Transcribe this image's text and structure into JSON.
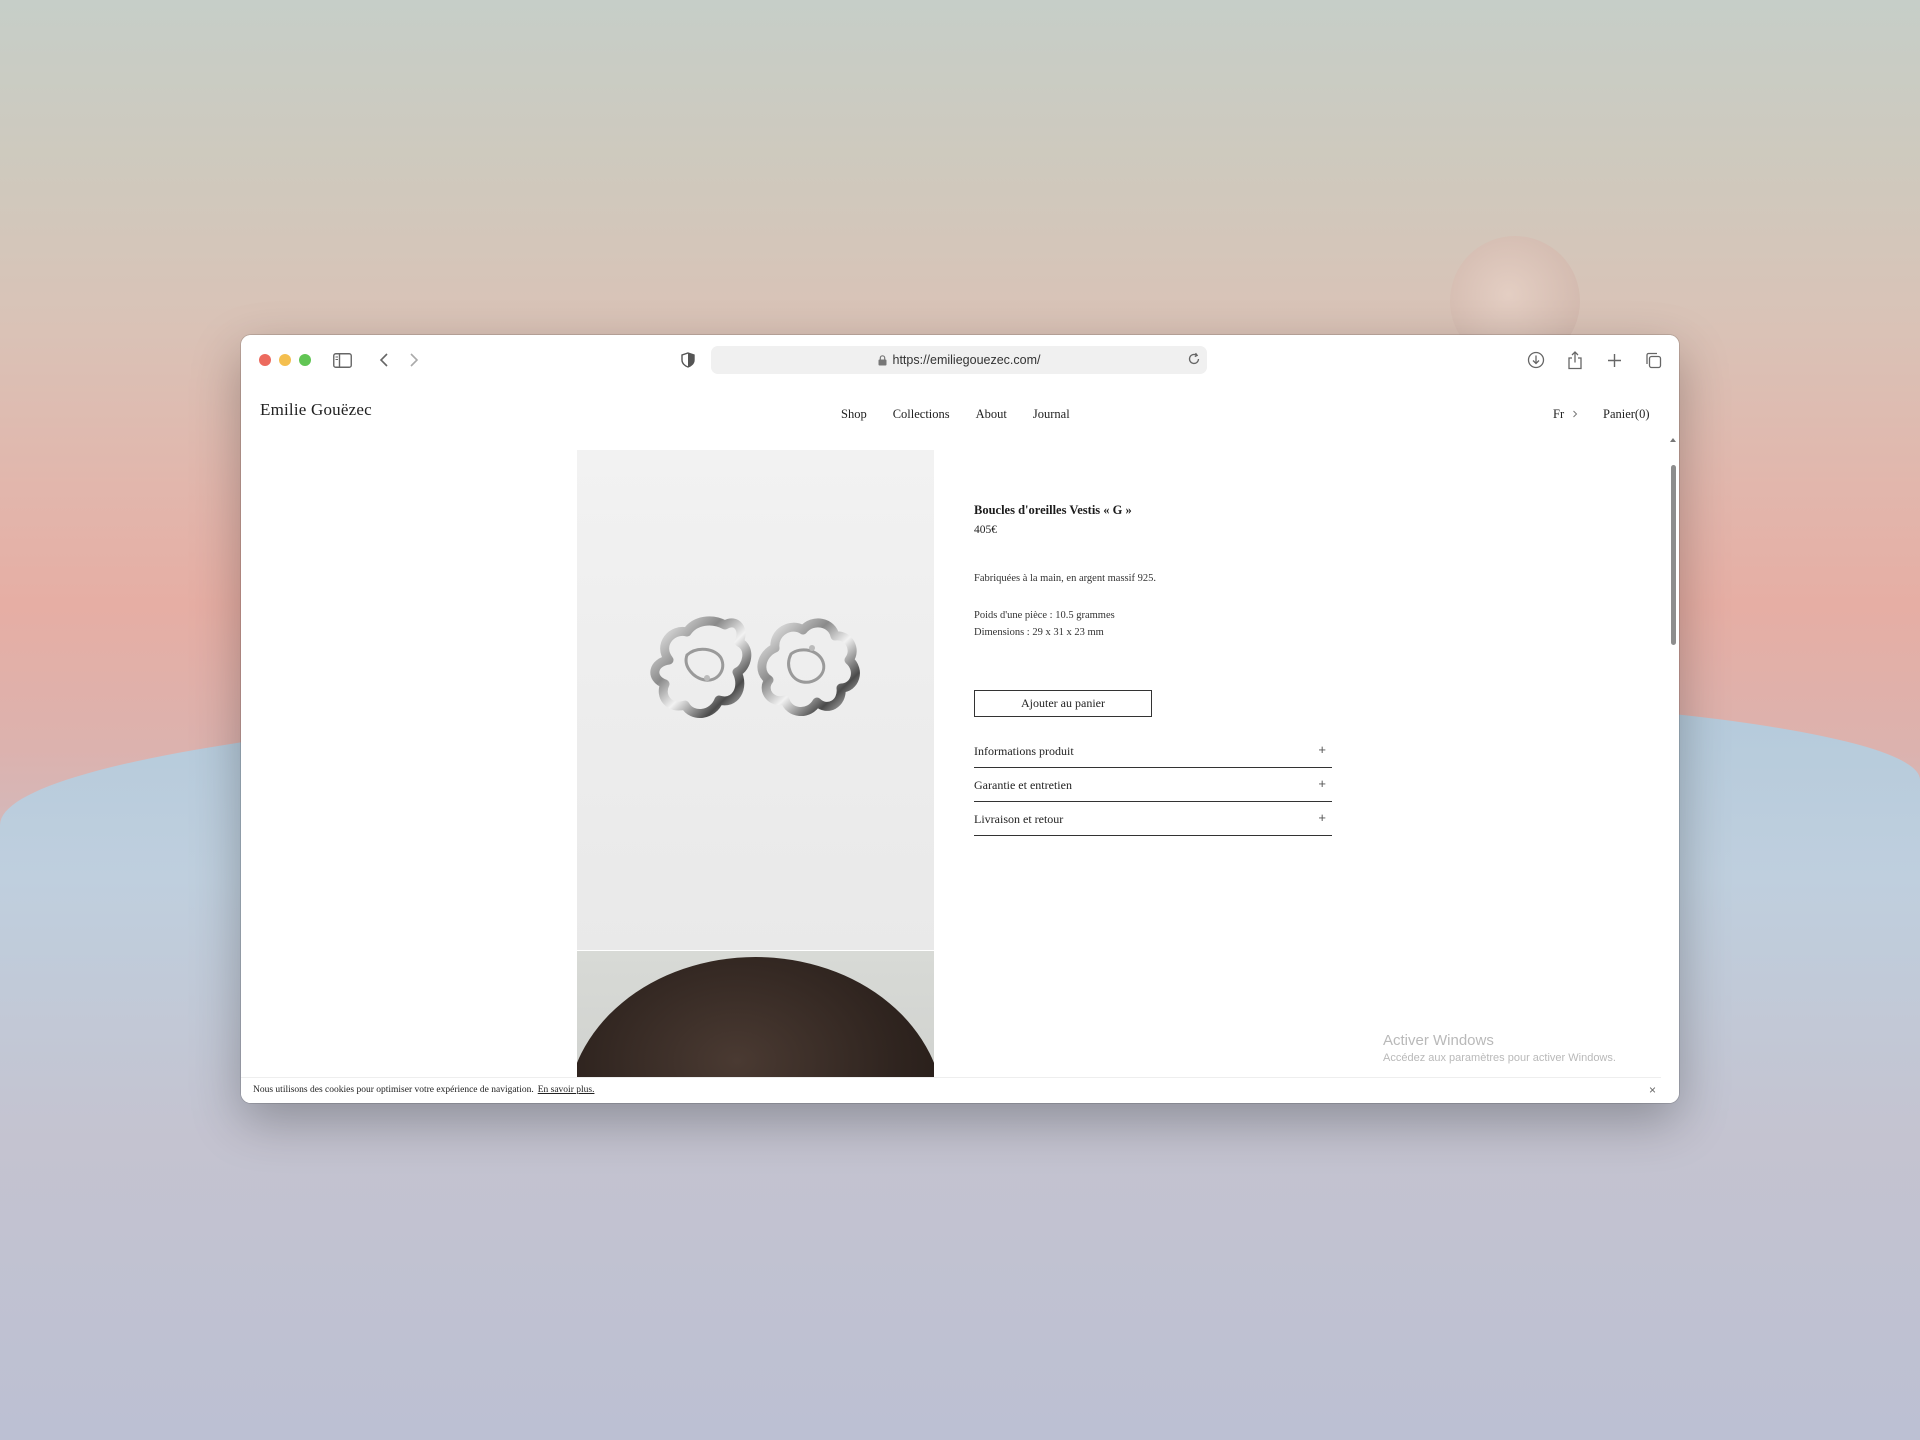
{
  "browser": {
    "url": "https://emiliegouezec.com/",
    "icons": [
      "sidebar-icon",
      "back-icon",
      "forward-icon",
      "shield-icon",
      "lock-icon",
      "reload-icon",
      "download-icon",
      "share-icon",
      "new-tab-icon",
      "tabs-overview-icon"
    ]
  },
  "site": {
    "brand": "Emilie Gouëzec",
    "nav": [
      "Shop",
      "Collections",
      "About",
      "Journal"
    ],
    "lang": "Fr",
    "cart": "Panier(0)"
  },
  "product": {
    "title": "Boucles d'oreilles Vestis « G »",
    "price": "405€",
    "description": "Fabriquées à la main,  en argent massif 925.",
    "weight": "Poids d'une pièce : 10.5 grammes",
    "dimensions": "Dimensions : 29 x 31 x 23 mm",
    "add_to_cart": "Ajouter au panier",
    "accordion": [
      {
        "label": "Informations produit",
        "toggle": "+"
      },
      {
        "label": "Garantie et entretien",
        "toggle": "+"
      },
      {
        "label": "Livraison et retour",
        "toggle": "+"
      }
    ]
  },
  "cookie": {
    "text": "Nous utilisons des cookies pour optimiser votre expérience de navigation.",
    "link": "En savoir plus.",
    "close": "×"
  },
  "watermark": {
    "line1": "Activer Windows",
    "line2": "Accédez aux paramètres pour activer Windows."
  },
  "colors": {
    "close": "#ec6a5e",
    "minimize": "#f4bf4f",
    "zoom": "#61c554",
    "text": "#222222"
  }
}
